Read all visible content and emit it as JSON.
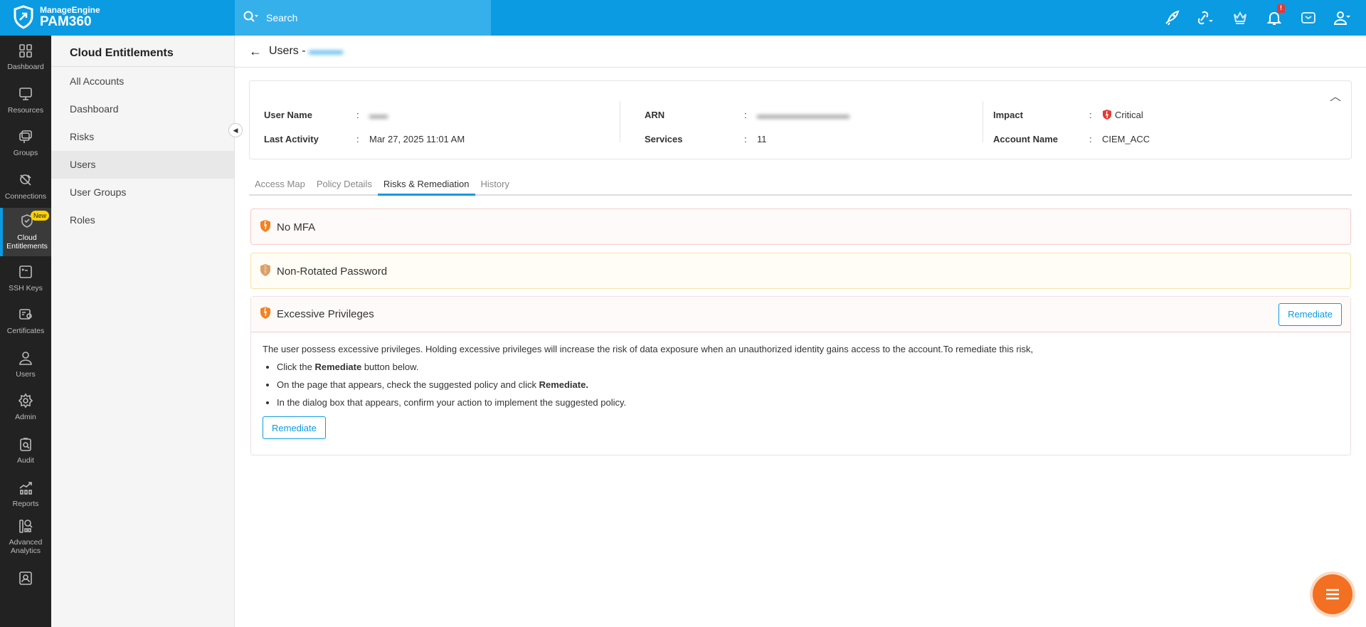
{
  "brand": {
    "line1": "ManageEngine",
    "line2": "PAM360"
  },
  "search": {
    "placeholder": "Search"
  },
  "top_icons": [
    "rocket-icon",
    "link-icon",
    "crown-icon",
    "bell-icon",
    "mail-icon",
    "user-icon"
  ],
  "notification_badge": "!",
  "rail": [
    {
      "label": "Dashboard"
    },
    {
      "label": "Resources"
    },
    {
      "label": "Groups"
    },
    {
      "label": "Connections"
    },
    {
      "label": "Cloud Entitlements",
      "badge": "New",
      "active": true
    },
    {
      "label": "SSH Keys"
    },
    {
      "label": "Certificates"
    },
    {
      "label": "Users"
    },
    {
      "label": "Admin"
    },
    {
      "label": "Audit"
    },
    {
      "label": "Reports"
    },
    {
      "label": "Advanced Analytics"
    }
  ],
  "sidebar": {
    "title": "Cloud Entitlements",
    "items": [
      "All Accounts",
      "Dashboard",
      "Risks",
      "Users",
      "User Groups",
      "Roles"
    ],
    "active": "Users"
  },
  "page": {
    "title": "Users - "
  },
  "details": {
    "user_name_label": "User Name",
    "last_activity_label": "Last Activity",
    "last_activity": "Mar 27, 2025 11:01 AM",
    "arn_label": "ARN",
    "services_label": "Services",
    "services": "11",
    "impact_label": "Impact",
    "impact": "Critical",
    "account_name_label": "Account Name",
    "account_name": "CIEM_ACC",
    "colon": ":"
  },
  "tabs": [
    "Access Map",
    "Policy Details",
    "Risks & Remediation",
    "History"
  ],
  "active_tab": "Risks & Remediation",
  "risks": [
    {
      "title": "No MFA",
      "color": "#f8c9c9"
    },
    {
      "title": "Non-Rotated Password",
      "color": "#f9e2a6"
    },
    {
      "title": "Excessive Privileges",
      "color": "#f8c9c9",
      "button": "Remediate",
      "description": "The user possess excessive privileges. Holding excessive privileges will increase the risk of data exposure when an unauthorized identity gains access to the account.To remediate this risk,",
      "steps": [
        {
          "pre": "Click the ",
          "bold": "Remediate",
          "post": " button below."
        },
        {
          "pre": "On the page that appears, check the suggested policy and click ",
          "bold": "Remediate.",
          "post": ""
        },
        {
          "pre": "In the dialog box that appears, confirm your action to implement the suggested policy.",
          "bold": "",
          "post": ""
        }
      ],
      "body_button": "Remediate"
    }
  ],
  "colors": {
    "brand": "#0a9be2",
    "fab": "#f36f21",
    "critical": "#e53935"
  }
}
